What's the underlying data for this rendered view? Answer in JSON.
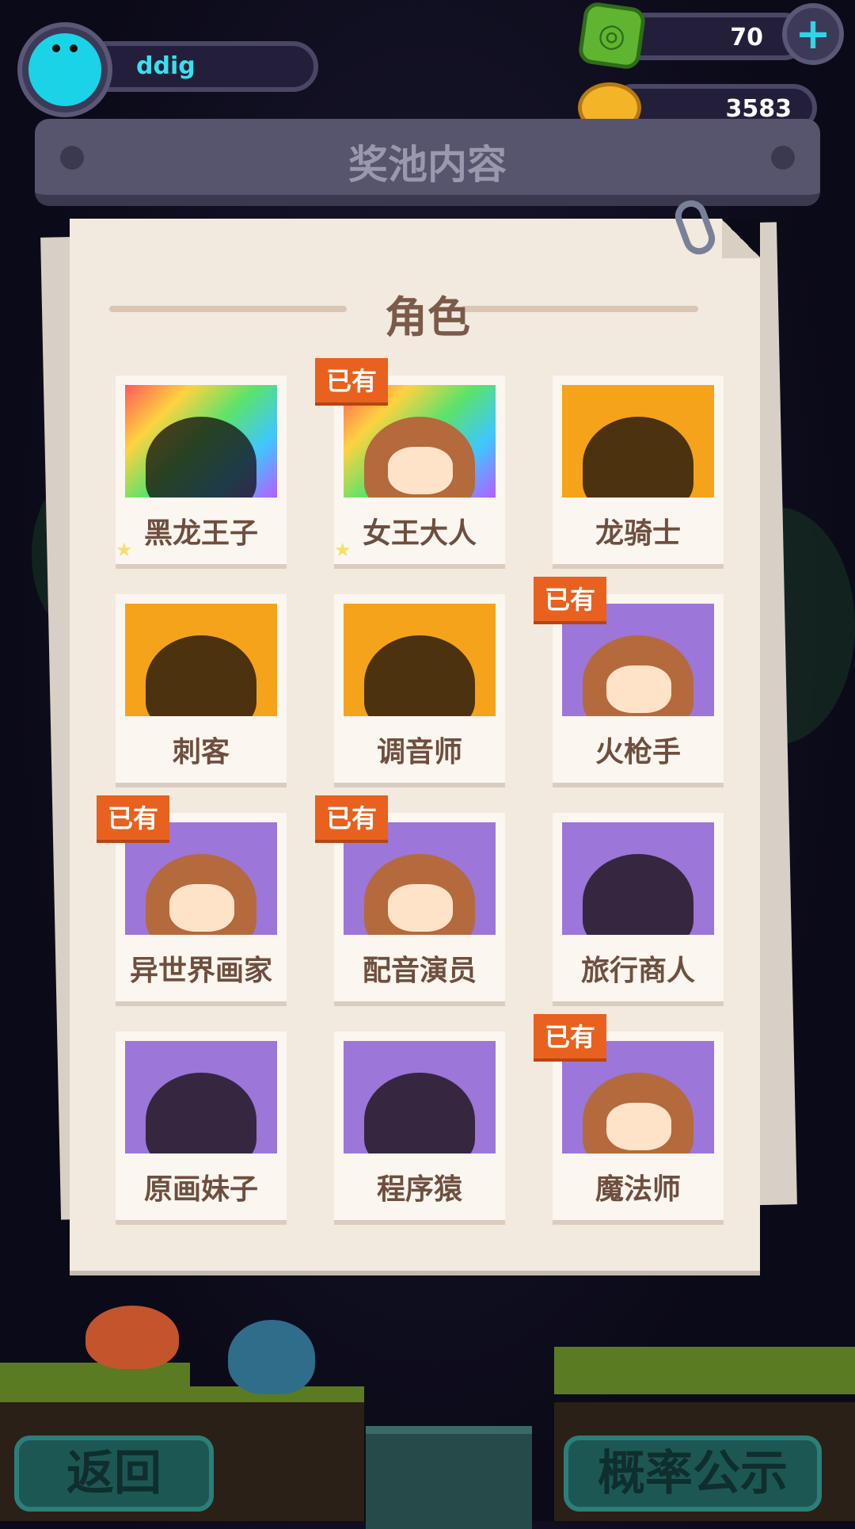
{
  "header": {
    "username": "ddig",
    "gems": "70",
    "coins": "3583"
  },
  "panel": {
    "title": "奖池内容",
    "section": "角色"
  },
  "owned_badge": "已有",
  "characters": [
    {
      "name": "黑龙王子",
      "bg": "rainbow",
      "owned": false,
      "stars": true
    },
    {
      "name": "女王大人",
      "bg": "rainbow",
      "owned": true,
      "stars": true
    },
    {
      "name": "龙骑士",
      "bg": "#f5a31a",
      "owned": false,
      "stars": false
    },
    {
      "name": "刺客",
      "bg": "#f5a31a",
      "owned": false,
      "stars": false
    },
    {
      "name": "调音师",
      "bg": "#f5a31a",
      "owned": false,
      "stars": false
    },
    {
      "name": "火枪手",
      "bg": "#9c76d8",
      "owned": true,
      "stars": false
    },
    {
      "name": "异世界画家",
      "bg": "#9c76d8",
      "owned": true,
      "stars": false
    },
    {
      "name": "配音演员",
      "bg": "#9c76d8",
      "owned": true,
      "stars": false
    },
    {
      "name": "旅行商人",
      "bg": "#9c76d8",
      "owned": false,
      "stars": false
    },
    {
      "name": "原画妹子",
      "bg": "#9c76d8",
      "owned": false,
      "stars": false
    },
    {
      "name": "程序猿",
      "bg": "#9c76d8",
      "owned": false,
      "stars": false
    },
    {
      "name": "魔法师",
      "bg": "#9c76d8",
      "owned": true,
      "stars": false
    }
  ],
  "footer": {
    "back_label": "返回",
    "odds_label": "概率公示"
  },
  "colors": {
    "accent_cyan": "#1bd3e7",
    "badge_orange": "#e8611e",
    "paper": "#f2e9df"
  }
}
